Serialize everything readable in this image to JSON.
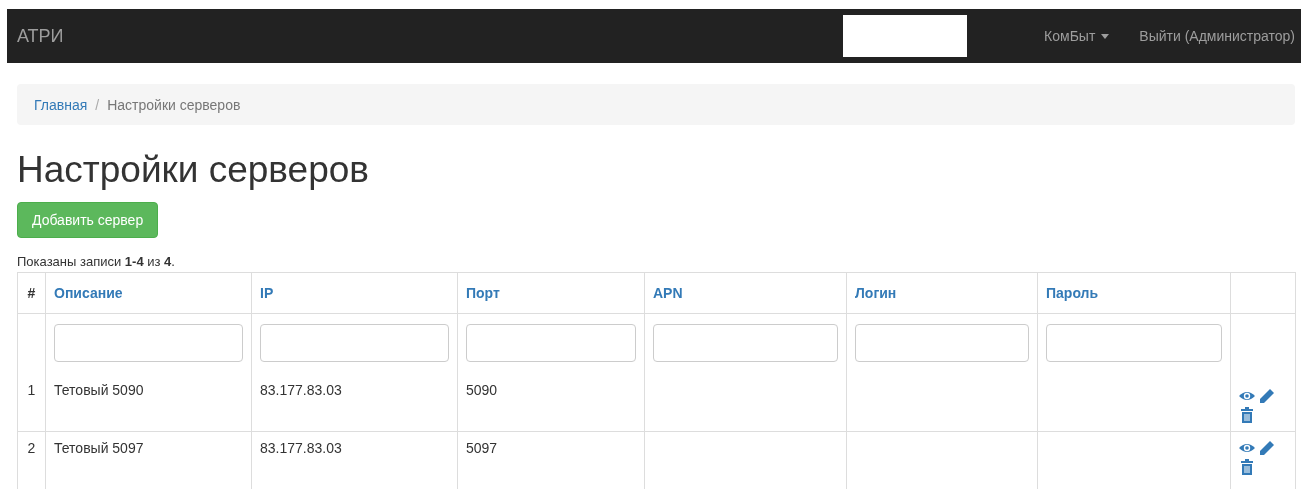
{
  "navbar": {
    "brand": "АТРИ",
    "menu": [
      {
        "label": "КомБыт",
        "kind": "dropdown"
      },
      {
        "label": "Выйти (Администратор)",
        "kind": "link"
      }
    ]
  },
  "breadcrumb_separator": "/",
  "breadcrumb": [
    {
      "label": "Главная",
      "kind": "link"
    },
    {
      "label": "Настройки серверов",
      "kind": "current"
    }
  ],
  "heading": "Настройки серверов",
  "add_button": "Добавить сервер",
  "summary": "Показаны записи **1-4** из **4**.",
  "table": {
    "columns": [
      "#",
      "Описание",
      "IP",
      "Порт",
      "APN",
      "Логин",
      "Пароль"
    ],
    "rows": [
      {
        "index": "1",
        "description": "Тетовый 5090",
        "ip": "83.177.83.03",
        "port": "5090"
      },
      {
        "index": "2",
        "description": "Тетовый 5097",
        "ip": "83.177.83.03",
        "port": "5097"
      }
    ]
  }
}
